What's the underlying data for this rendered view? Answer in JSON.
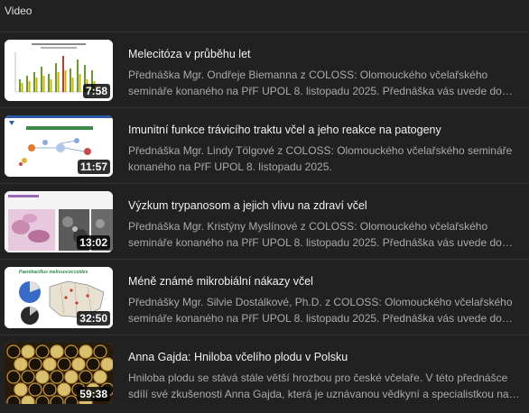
{
  "header": {
    "title": "Video"
  },
  "videos": [
    {
      "title": "Melecitóza v průběhu let",
      "description": "Přednáška Mgr. Ondřeje Biemanna z COLOSS: Olomouckého včelařského semináře konaného na PřF UPOL 8. listopadu 2025. Přednáška vás uvede do problematiky melecitózy",
      "duration": "7:58",
      "thumb_icon": "bar-chart-slide-thumbnail"
    },
    {
      "title": "Imunitní funkce trávicího traktu včel a jeho reakce na patogeny",
      "description": "Přednáška Mgr. Lindy Tölgové z COLOSS: Olomouckého včelařského semináře konaného na PřF UPOL 8. listopadu 2025.",
      "duration": "11:57",
      "thumb_icon": "diagram-slide-thumbnail"
    },
    {
      "title": "Výzkum trypanosom a jejich vlivu na zdraví včel",
      "description": "Přednáška Mgr. Kristýny Myslínové z COLOSS: Olomouckého včelařského semináře konaného na PřF UPOL 8. listopadu 2025. Přednáška vás uvede do problematiky trypanosom",
      "duration": "13:02",
      "thumb_icon": "microscopy-slide-thumbnail"
    },
    {
      "title": "Méně známé mikrobiální nákazy včel",
      "description": "Přednášky Mgr. Silvie Dostálkové, Ph.D. z COLOSS: Olomouckého včelařského semináře konaného na PřF UPOL 8. listopadu 2025. Přednáška vás uvede do problematiky",
      "duration": "32:50",
      "thumb_icon": "map-slide-thumbnail",
      "thumb_heading": "Paenibacillus melissococcoides"
    },
    {
      "title": "Anna Gajda: Hniloba včelího plodu v Polsku",
      "description": "Hniloba plodu se stává stále větší hrozbou pro české včelaře. V této přednášce sdílí své zkušenosti Anna Gajda, která je uznávanou vědkyní a specialistkou na nemoci včel",
      "duration": "59:38",
      "thumb_icon": "honeycomb-photo-thumbnail"
    }
  ]
}
